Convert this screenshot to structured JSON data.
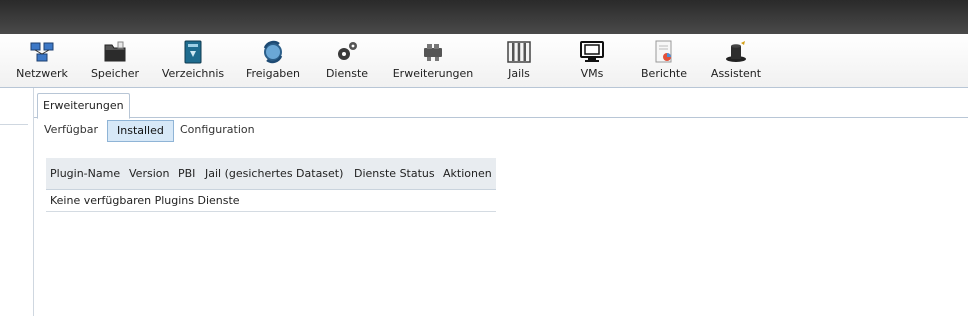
{
  "toolbar": {
    "items": [
      {
        "label": "Netzwerk",
        "icon": "network-icon"
      },
      {
        "label": "Speicher",
        "icon": "storage-icon"
      },
      {
        "label": "Verzeichnis",
        "icon": "directory-icon"
      },
      {
        "label": "Freigaben",
        "icon": "sharing-icon"
      },
      {
        "label": "Dienste",
        "icon": "services-gear-icon"
      },
      {
        "label": "Erweiterungen",
        "icon": "plugins-icon"
      },
      {
        "label": "Jails",
        "icon": "jails-icon"
      },
      {
        "label": "VMs",
        "icon": "vms-monitor-icon"
      },
      {
        "label": "Berichte",
        "icon": "reports-icon"
      },
      {
        "label": "Assistent",
        "icon": "wizard-hat-icon"
      }
    ]
  },
  "main": {
    "tab": "Erweiterungen",
    "subtabs": [
      "Verfügbar",
      "Installed",
      "Configuration"
    ],
    "active_subtab": "Installed",
    "table": {
      "columns": [
        "Plugin-Name",
        "Version",
        "PBI",
        "Jail (gesichertes Dataset)",
        "Dienste Status",
        "Aktionen"
      ],
      "empty_message": "Keine verfügbaren Plugins Dienste"
    }
  },
  "colors": {
    "topbar": "#3a3a3a",
    "active_subtab_bg": "#d7e8f7",
    "table_header_bg": "#e8ecf0"
  }
}
